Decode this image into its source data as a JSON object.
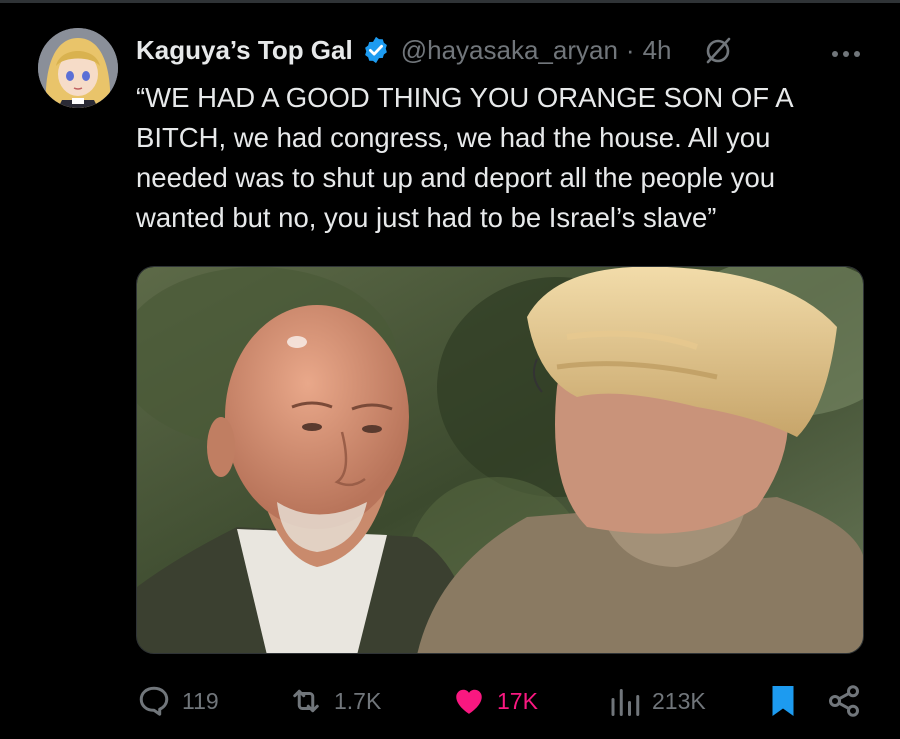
{
  "tweet": {
    "author": {
      "display_name": "Kaguya’s Top Gal",
      "handle": "@hayasaka_aryan",
      "verified": true
    },
    "separator": "·",
    "timestamp": "4h",
    "text": "“WE HAD A GOOD THING YOU ORANGE SON OF A BITCH, we had congress, we had the house. All you needed was to shut up and deport all the people you wanted but no, you just had to be Israel’s slave”",
    "icons": {
      "verified": "verified-badge-icon",
      "grok": "grok-icon",
      "more": "more-icon"
    }
  },
  "actions": {
    "reply": {
      "icon": "reply-icon",
      "count": "119"
    },
    "retweet": {
      "icon": "retweet-icon",
      "count": "1.7K"
    },
    "like": {
      "icon": "heart-icon",
      "count": "17K",
      "active": true
    },
    "views": {
      "icon": "views-icon",
      "count": "213K"
    },
    "bookmark": {
      "icon": "bookmark-icon",
      "active": true
    },
    "share": {
      "icon": "share-icon"
    }
  },
  "colors": {
    "background": "#000000",
    "text": "#e7e9ea",
    "muted": "#71767b",
    "verified": "#1d9bf0",
    "like_active": "#f91880",
    "bookmark_active": "#1d9bf0"
  }
}
